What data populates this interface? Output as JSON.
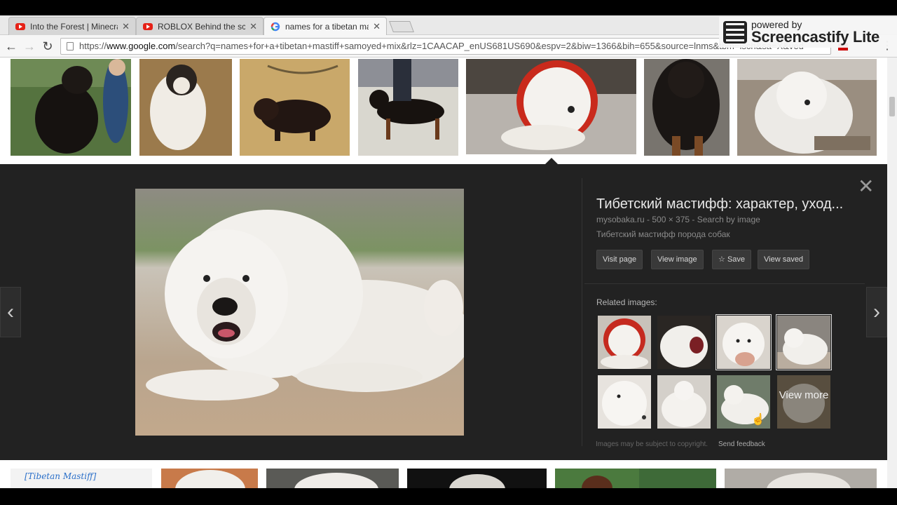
{
  "tabs": [
    {
      "title": "Into the Forest | Minecraft",
      "favicon": "youtube-icon"
    },
    {
      "title": "ROBLOX Behind the scenes",
      "favicon": "youtube-icon"
    },
    {
      "title": "names for a tibetan mastiff",
      "favicon": "google-icon",
      "active": true
    }
  ],
  "close_glyph": "✕",
  "screencastify": {
    "powered": "powered by",
    "brand": "Screencastify Lite"
  },
  "toolbar": {
    "back": "←",
    "forward": "→",
    "reload": "↻",
    "url_prefix": "https://",
    "url_host": "www.google.com",
    "url_rest": "/search?q=names+for+a+tibetan+mastiff+samoyed+mix&rlz=1CAACAP_enUS681US690&espv=2&biw=1366&bih=655&source=lnms&tbm=isch&sa=X&ved",
    "menu": "⋮"
  },
  "panel": {
    "title": "Тибетский мастифф: характер, уход...",
    "meta": "mysobaka.ru - 500 × 375 - Search by image",
    "description": "Тибетский мастифф порода собак",
    "buttons": {
      "visit": "Visit page",
      "view": "View image",
      "save": "Save",
      "saved": "View saved"
    },
    "save_icon": "☆",
    "related_label": "Related images:",
    "view_more": "View more",
    "copyright": "Images may be subject to copyright.",
    "feedback": "Send feedback",
    "close": "✕",
    "prev": "‹",
    "next": "›"
  },
  "bottom_row_label": "[Tibetan Mastiff]",
  "colors": {
    "panel": "#222222",
    "white_dog": "#f2f0ec",
    "black_dog": "#1e1a18"
  }
}
